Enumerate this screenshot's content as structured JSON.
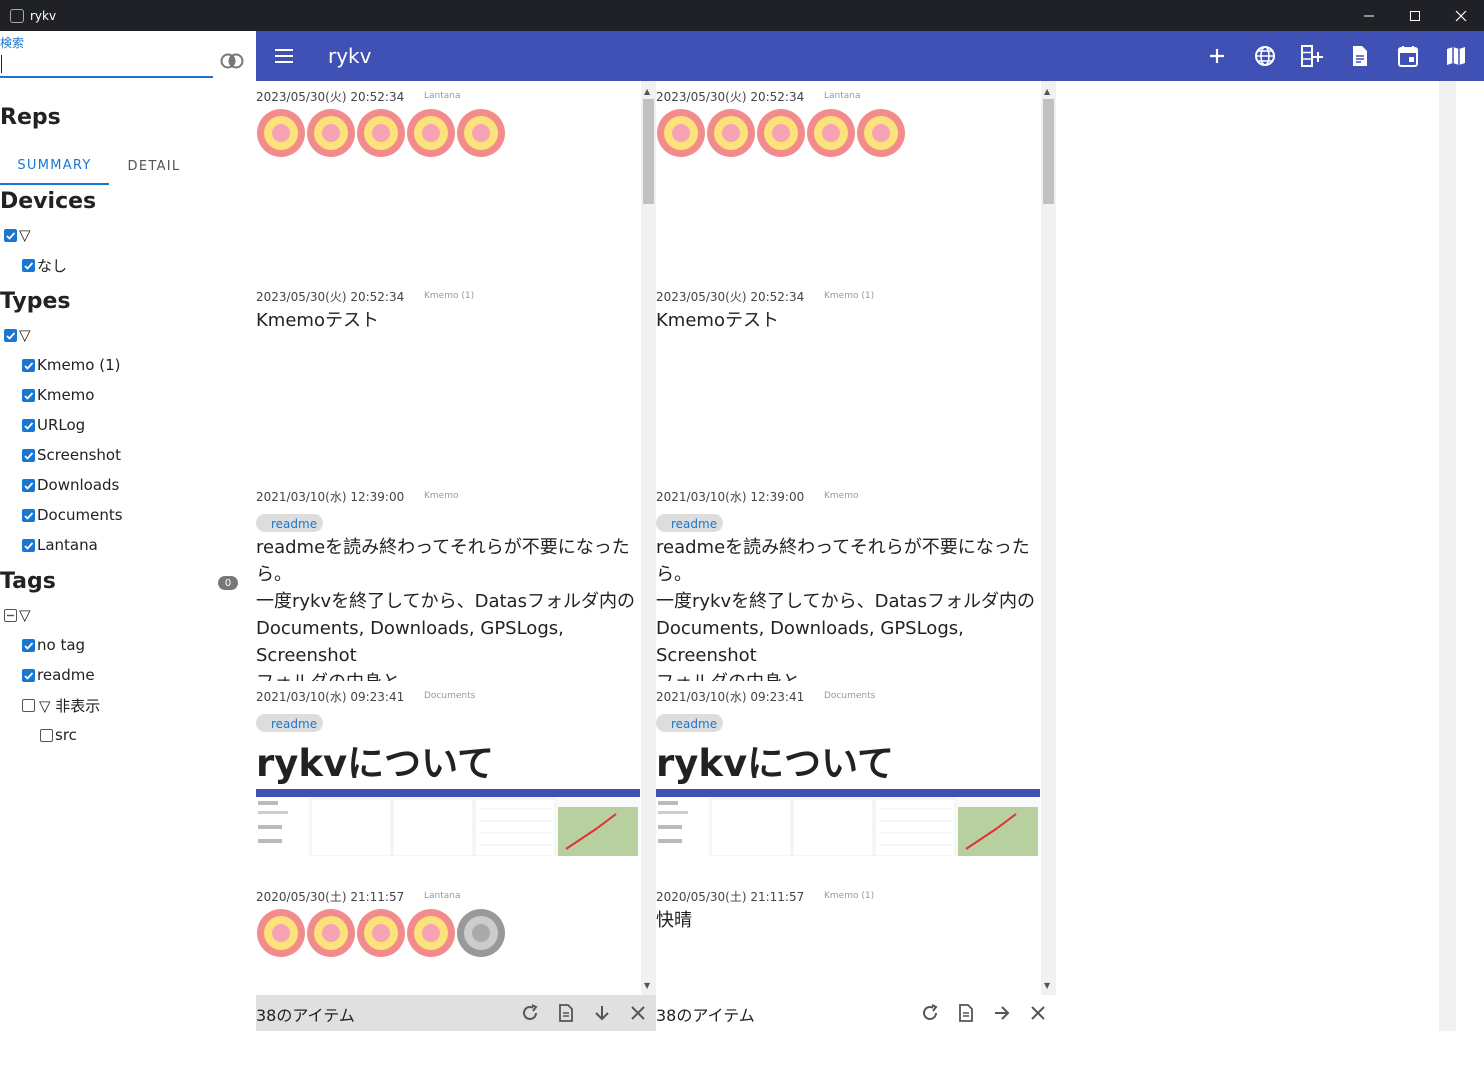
{
  "window": {
    "title": "rykv"
  },
  "sidebar": {
    "search_label": "検索",
    "search_value": "",
    "reps_title": "Reps",
    "tabs": [
      {
        "label": "SUMMARY",
        "active": true
      },
      {
        "label": "DETAIL",
        "active": false
      }
    ],
    "devices_title": "Devices",
    "devices": [
      {
        "label": "▽",
        "checked": true
      },
      {
        "label": "なし",
        "checked": true
      }
    ],
    "types_title": "Types",
    "types": [
      {
        "label": "▽",
        "checked": true
      },
      {
        "label": "Kmemo (1)",
        "checked": true
      },
      {
        "label": "Kmemo",
        "checked": true
      },
      {
        "label": "URLog",
        "checked": true
      },
      {
        "label": "Screenshot",
        "checked": true
      },
      {
        "label": "Downloads",
        "checked": true
      },
      {
        "label": "Documents",
        "checked": true
      },
      {
        "label": "Lantana",
        "checked": true
      }
    ],
    "tags_title": "Tags",
    "tags_badge": "0",
    "tags": [
      {
        "label": "▽",
        "state": "indeterminate"
      },
      {
        "label": "no tag",
        "state": "checked"
      },
      {
        "label": "readme",
        "state": "checked"
      },
      {
        "label": "▽ 非表示",
        "state": "unchecked"
      },
      {
        "label": "src",
        "state": "unchecked"
      }
    ]
  },
  "appbar": {
    "title": "rykv"
  },
  "columns": [
    {
      "items": [
        {
          "date": "2023/05/30(火) 20:52:34",
          "type": "Lantana",
          "kind": "flowers",
          "flowers": [
            "color",
            "color",
            "color",
            "color",
            "color"
          ]
        },
        {
          "date": "2023/05/30(火) 20:52:34",
          "type": "Kmemo (1)",
          "kind": "text",
          "text": "Kmemoテスト"
        },
        {
          "date": "2021/03/10(水) 12:39:00",
          "type": "Kmemo",
          "kind": "tagtext",
          "tag": "readme",
          "lines": [
            "readmeを読み終わってそれらが不要になった",
            "ら。",
            "一度rykvを終了してから、Datasフォルダ内の",
            "Documents, Downloads, GPSLogs, Screenshot",
            "フォルダの中身と"
          ]
        },
        {
          "date": "2021/03/10(水) 09:23:41",
          "type": "Documents",
          "kind": "doc",
          "tag": "readme",
          "heading": "rykvについて"
        },
        {
          "date": "2020/05/30(土) 21:11:57",
          "type": "Lantana",
          "kind": "flowers",
          "flowers": [
            "color",
            "color",
            "color",
            "color",
            "gray"
          ]
        }
      ],
      "footer": {
        "count": "38のアイテム"
      }
    },
    {
      "items": [
        {
          "date": "2023/05/30(火) 20:52:34",
          "type": "Lantana",
          "kind": "flowers",
          "flowers": [
            "color",
            "color",
            "color",
            "color",
            "color"
          ]
        },
        {
          "date": "2023/05/30(火) 20:52:34",
          "type": "Kmemo (1)",
          "kind": "text",
          "text": "Kmemoテスト"
        },
        {
          "date": "2021/03/10(水) 12:39:00",
          "type": "Kmemo",
          "kind": "tagtext",
          "tag": "readme",
          "lines": [
            "readmeを読み終わってそれらが不要になった",
            "ら。",
            "一度rykvを終了してから、Datasフォルダ内の",
            "Documents, Downloads, GPSLogs, Screenshot",
            "フォルダの中身と"
          ]
        },
        {
          "date": "2021/03/10(水) 09:23:41",
          "type": "Documents",
          "kind": "doc",
          "tag": "readme",
          "heading": "rykvについて"
        },
        {
          "date": "2020/05/30(土) 21:11:57",
          "type": "Kmemo (1)",
          "kind": "text",
          "text": "快晴"
        }
      ],
      "footer": {
        "count": "38のアイテム"
      }
    }
  ],
  "colors": {
    "primary": "#3f51b5",
    "accent": "#1976d2"
  }
}
